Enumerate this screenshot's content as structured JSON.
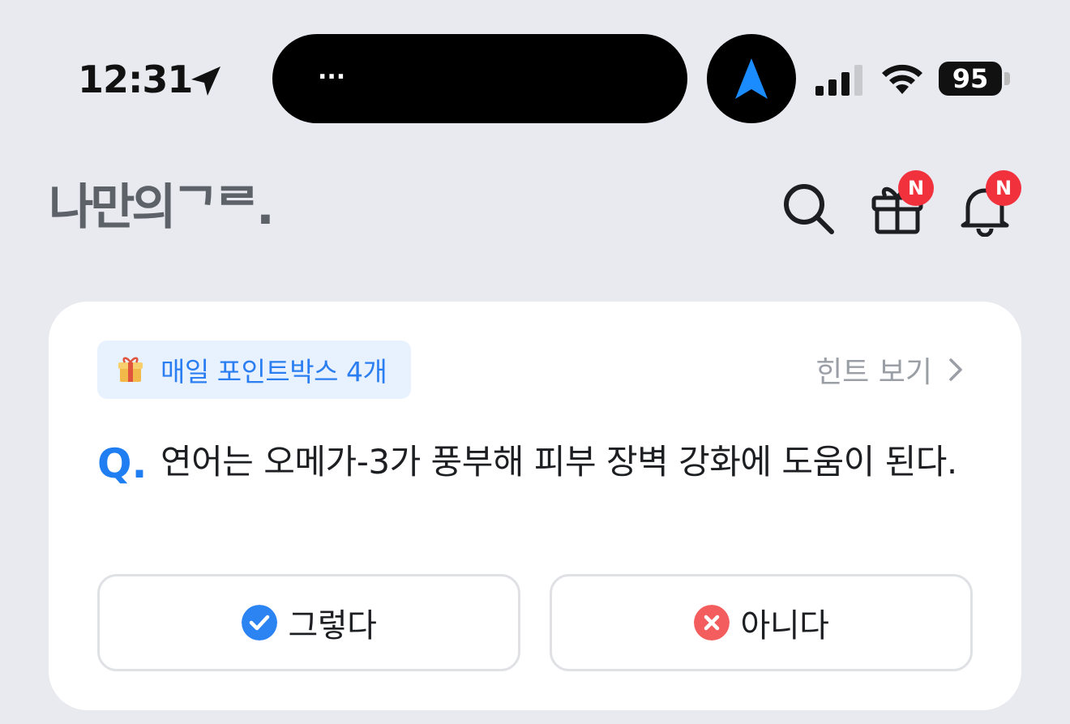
{
  "status_bar": {
    "time": "12:31",
    "island_text": "...",
    "battery": "95"
  },
  "header": {
    "logo": "나만의ᄀᄅ.",
    "gift_badge": "N",
    "bell_badge": "N"
  },
  "quiz_card": {
    "chip_label": "매일 포인트박스 4개",
    "hint_label": "힌트 보기",
    "question_mark": "Q.",
    "question": "연어는 오메가-3가 풍부해 피부 장벽 강화에 도움이 된다.",
    "answers": [
      {
        "label": "그렇다",
        "icon": "check-circle-icon",
        "color": "#2b84f2"
      },
      {
        "label": "아니다",
        "icon": "x-circle-icon",
        "color": "#f35d5d"
      }
    ]
  },
  "colors": {
    "accent": "#1f7ef2",
    "badge": "#f1323d",
    "background": "#e8eaf0"
  }
}
